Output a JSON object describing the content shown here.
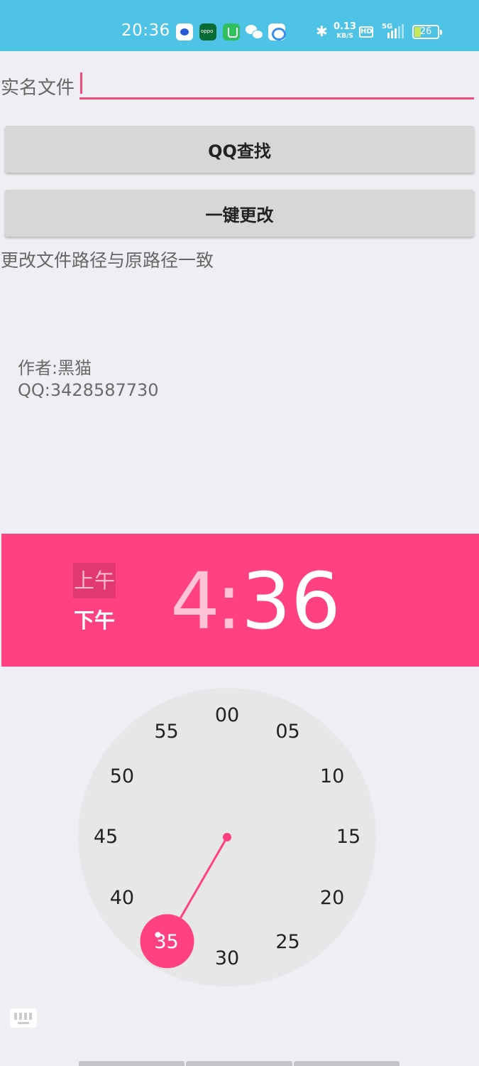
{
  "status_bar": {
    "time": "20:36",
    "net_speed_value": "0.13",
    "net_speed_unit": "KB/S",
    "hd_label": "HD",
    "network_type": "5G",
    "battery_level": "26",
    "icons": [
      "baidu-icon",
      "oppo-icon",
      "app-market-icon",
      "wechat-icon",
      "baidu-netdisk-icon",
      "bluetooth-icon",
      "hd-icon",
      "signal-icon",
      "battery-icon"
    ]
  },
  "form": {
    "field_label": "实名文件",
    "field_value": "",
    "qq_search_button": "QQ查找",
    "one_click_change_button": "一键更改",
    "hint": "更改文件路径与原路径一致"
  },
  "author": {
    "line1": "作者:黑猫",
    "line2": "QQ:3428587730"
  },
  "time_picker": {
    "am_label": "上午",
    "pm_label": "下午",
    "selected_period": "pm",
    "hour": "4",
    "colon": ":",
    "minute": "36",
    "accent_color": "#ff4081",
    "minute_ticks": [
      "00",
      "05",
      "10",
      "15",
      "20",
      "25",
      "30",
      "35",
      "40",
      "45",
      "50",
      "55"
    ],
    "selected_tick": "35"
  }
}
